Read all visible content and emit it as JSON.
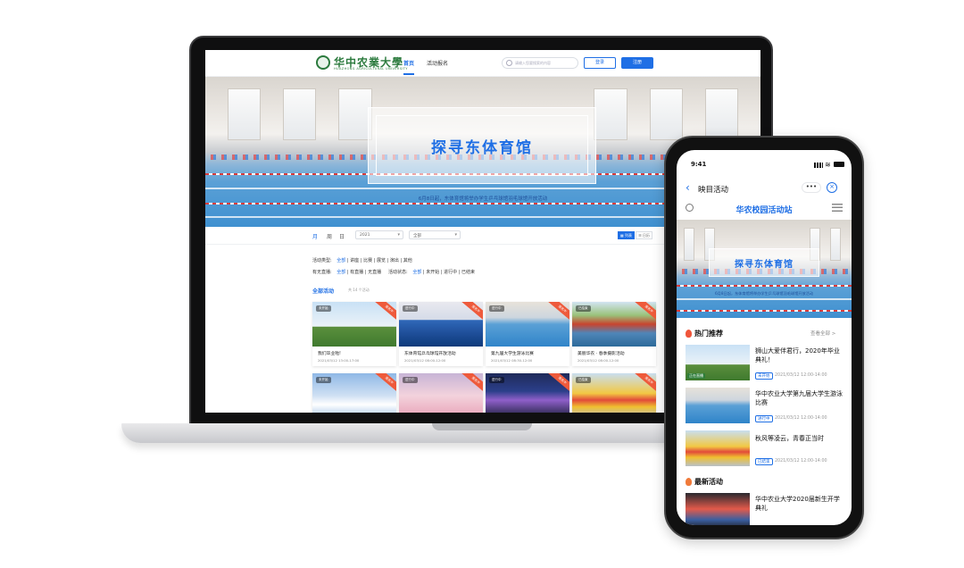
{
  "web": {
    "logo_text": "华中农業大學",
    "logo_sub": "HUAZHONG AGRICULTURAL UNIVERSITY",
    "nav": {
      "home": "首页",
      "activity": "活动报名"
    },
    "search_placeholder": "请输入您要搜索的内容",
    "login": "登录",
    "register": "注册",
    "hero": {
      "title": "探寻东体育馆",
      "subtitle": "6月8日起，东体育馆将举办学生乒乓球馆羽毛球馆开放活动"
    },
    "filter": {
      "month": "月",
      "week": "周",
      "day": "日",
      "select1": "2021",
      "select2": "全部",
      "view_grid": "▦ 列表",
      "view_list": "☰ 日历"
    },
    "type_row": {
      "label": "活动类型:",
      "items": [
        "全部",
        "讲座",
        "比赛",
        "展览",
        "演出",
        "其他"
      ]
    },
    "status_row": {
      "label": "有无直播:",
      "items": [
        "全部",
        "有直播",
        "无直播"
      ],
      "label2": "活动状态:",
      "items2": [
        "全部",
        "未开始",
        "进行中",
        "已结束"
      ]
    },
    "all_label": "全部活动",
    "all_count": "共 14 个活动",
    "cards": [
      {
        "badge": "未开始",
        "ribbon": "报名中",
        "title": "我们毕业啦!",
        "date": "2021/03/12 13:00-17:00"
      },
      {
        "badge": "进行中",
        "ribbon": "报名中",
        "title": "东体育馆乒乓球馆开放活动",
        "date": "2021/03/12 08:00-12:00"
      },
      {
        "badge": "进行中",
        "ribbon": "报名中",
        "title": "第九届大学生游泳比赛",
        "date": "2021/03/12 08:30-12:00"
      },
      {
        "badge": "已结束",
        "ribbon": "报名中",
        "title": "美丽华农 · 春季摄影活动",
        "date": "2021/03/12 08:00-12:00"
      },
      {
        "badge": "未开始",
        "ribbon": "报名中"
      },
      {
        "badge": "进行中",
        "ribbon": "报名中"
      },
      {
        "badge": "进行中",
        "ribbon": "报名中"
      },
      {
        "badge": "已结束",
        "ribbon": "报名中"
      }
    ]
  },
  "phone": {
    "time": "9:41",
    "nav_title": "映目活动",
    "more": "•••",
    "close": "⊗",
    "app_title": "华农校园活动站",
    "hero": {
      "title": "探寻东体育馆",
      "subtitle": "6月8日起，东体育馆将举办学生乒乓球馆羽毛球馆开放活动"
    },
    "hot_title": "热门推荐",
    "see_all": "查看全部 >",
    "hot_items": [
      {
        "title": "狮山大爱伴君行，2020年毕业典礼！",
        "tag": "未开始",
        "badge": "正在直播",
        "date": "2021/03/12 12:00-14:00"
      },
      {
        "title": "华中农业大学第九届大学生游泳比赛",
        "tag": "进行中",
        "date": "2021/03/12 12:00-14:00"
      },
      {
        "title": "秋风等凌云，青春正当时",
        "tag": "已结束",
        "date": "2021/03/12 12:00-14:00"
      }
    ],
    "new_title": "最新活动",
    "new_items": [
      {
        "title": "华中农业大学2020届新生开学典礼"
      }
    ]
  }
}
